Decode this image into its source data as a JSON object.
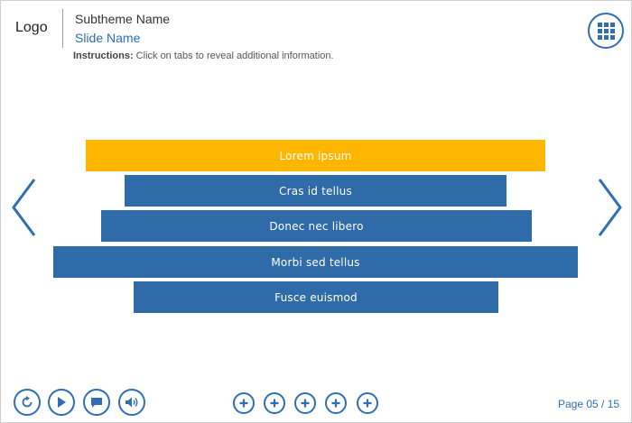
{
  "header": {
    "logo": "Logo",
    "subtheme": "Subtheme Name",
    "slide_name": "Slide Name",
    "instructions_label": "Instructions:",
    "instructions_text": " Click on tabs to reveal additional information."
  },
  "menu": {
    "icon": "grid-menu-icon"
  },
  "tabs": [
    {
      "label": "Lorem ipsum",
      "active": true
    },
    {
      "label": "Cras id tellus",
      "active": false
    },
    {
      "label": "Donec nec libero",
      "active": false
    },
    {
      "label": "Morbi sed tellus",
      "active": false
    },
    {
      "label": "Fusce euismod",
      "active": false
    }
  ],
  "controls": [
    "replay-icon",
    "play-icon",
    "captions-icon",
    "volume-icon"
  ],
  "footer": {
    "page_indicator": "Page 05 / 15"
  },
  "colors": {
    "accent": "#2f6eb0",
    "tab": "#2e6ba8",
    "tab_active": "#ffb600"
  }
}
